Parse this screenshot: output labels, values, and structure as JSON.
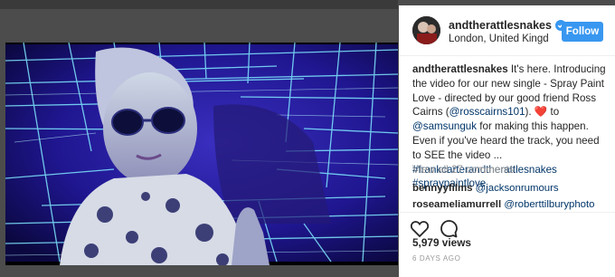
{
  "post": {
    "username": "andtherattlesnakes",
    "location": "London, United Kingd...",
    "follow_label": "Follow"
  },
  "caption": {
    "author": "andtherattlesnakes",
    "text_1": " It's here. Introducing the video for our new single - Spray Paint Love - directed by our good friend Ross Cairns (",
    "mention_1": "@rosscairns101",
    "text_2": "). ",
    "heart_emoji": "❤️",
    "text_3": " to ",
    "mention_2": "@samsunguk",
    "text_4": " for making this happen. Even if you've heard the track, you need to SEE the video ... ",
    "hashtag_1": "#frankcarterandtherattlesnakes",
    "hashtag_2": "#spraypaintlove"
  },
  "comments": {
    "view_all": "View all 27 comments",
    "items": [
      {
        "user": "bennyyfilms",
        "text": "@jacksonrumours"
      },
      {
        "user": "roseameliamurrell",
        "text": "@roberttilburyphoto"
      }
    ]
  },
  "stats": {
    "views": "5,979 views",
    "date": "6 DAYS AGO"
  },
  "icons": {
    "verified": "verified-badge-icon",
    "like": "heart-icon",
    "comment": "comment-bubble-icon"
  },
  "colors": {
    "accent": "#3897f0",
    "link": "#003569",
    "muted": "#999999",
    "text": "#262626"
  }
}
